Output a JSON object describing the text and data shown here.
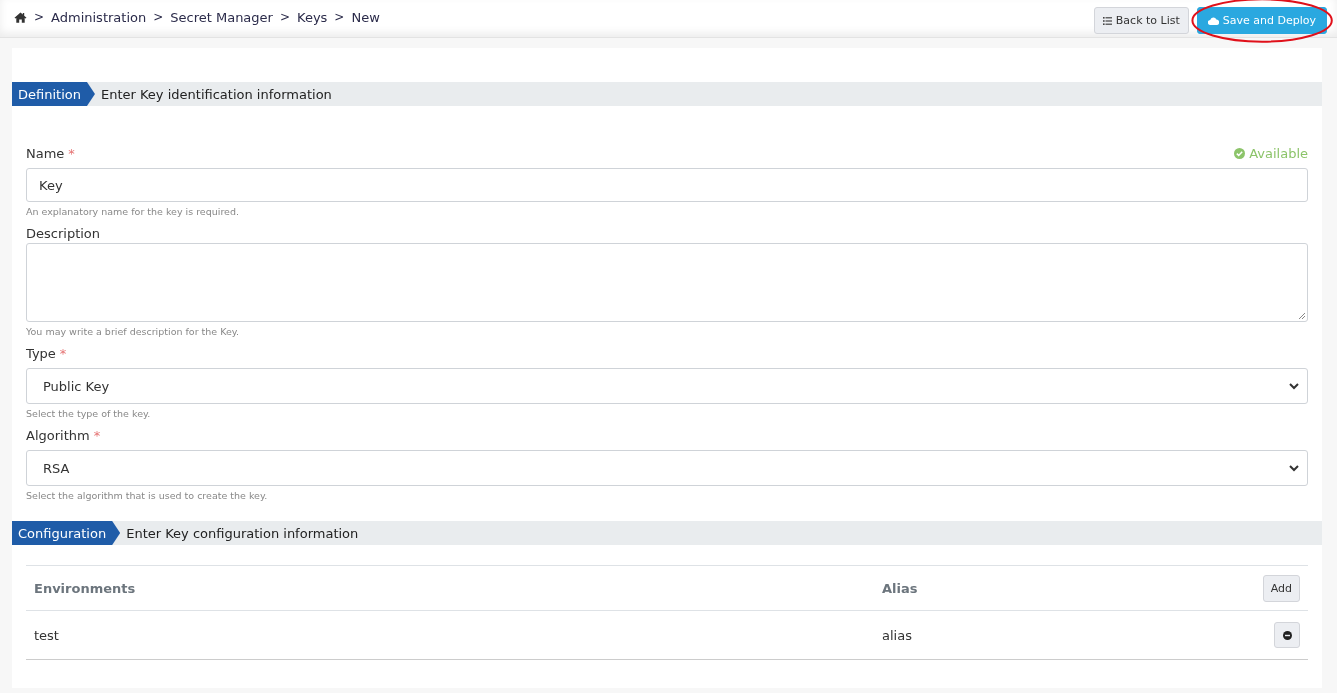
{
  "breadcrumb": [
    {
      "separator": ">",
      "label": "Administration"
    },
    {
      "separator": ">",
      "label": "Secret Manager"
    },
    {
      "separator": ">",
      "label": "Keys"
    },
    {
      "separator": ">",
      "label": "New"
    }
  ],
  "actions": [
    {
      "kind": "list",
      "label": "Back to List",
      "highlighted": false
    },
    {
      "kind": "deploy",
      "label": "Save and Deploy",
      "highlighted": true
    }
  ],
  "sections": [
    {
      "tag": "Definition",
      "title": "Enter Key identification information"
    },
    {
      "tag": "Configuration",
      "title": "Enter Key configuration information"
    }
  ],
  "fields": [
    {
      "kind": "text",
      "label": "Name",
      "required_mark": "*",
      "value": "Key",
      "help": "An explanatory name for the key is required.",
      "status": "Available"
    },
    {
      "kind": "textarea",
      "label": "Description",
      "help": "You may write a brief description for the Key."
    },
    {
      "kind": "select",
      "label": "Type",
      "required_mark": "*",
      "value": "Public Key",
      "help": "Select the type of the key."
    },
    {
      "kind": "select",
      "label": "Algorithm",
      "required_mark": "*",
      "value": "RSA",
      "help": "Select the algorithm that is used to create the key."
    }
  ],
  "table": {
    "columns": [
      "Environments",
      "Alias"
    ],
    "add_button": "Add",
    "rows": [
      {
        "environment": "test",
        "alias": "alias"
      }
    ]
  }
}
